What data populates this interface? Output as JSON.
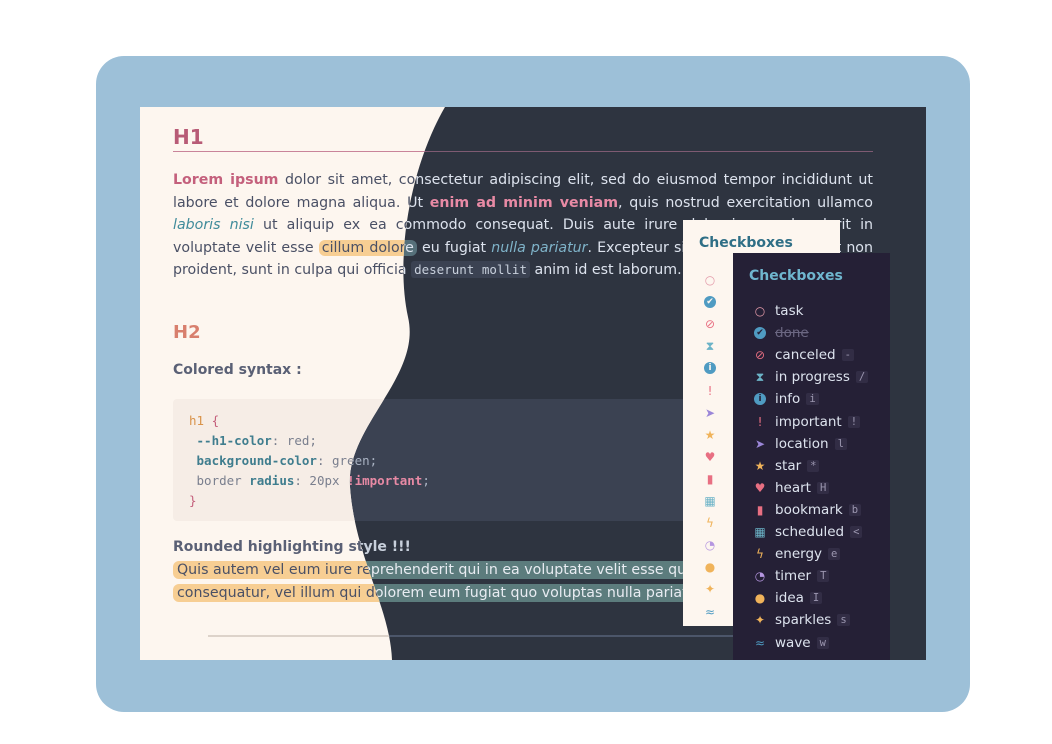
{
  "colors": {
    "frame": "#9dc0d8",
    "light_bg": "#fdf6ef",
    "dark_bg": "#2e3440",
    "h1_light": "#b85b76",
    "h2_light": "#d87f6d",
    "accent_teal": "#3f8b9a",
    "highlight_orange": "#f7ce93",
    "highlight_teal": "#5c7c7d",
    "panel_dark_bg": "#252036",
    "panel_light_bg": "#fdf6ef"
  },
  "doc": {
    "h1": "H1",
    "para": {
      "p1_bold": "Lorem ipsum",
      "p2": " dolor sit amet, consectetur adipiscing elit, sed do eiusmod tempor incididunt ut labore et dolore magna aliqua. Ut ",
      "p3_strong": "enim ad minim veniam",
      "p4": ", quis nostrud exercitation ullamco ",
      "p5_italic": "laboris nisi",
      "p6": " ut aliquip ex ea commodo consequat. Duis aute irure dolor in reprehenderit in voluptate velit esse ",
      "p7_mark": "cillum dolore",
      "p8": " eu fugiat ",
      "p9_italic": "nulla pariatur",
      "p10": ". Excepteur sint occaecat cupidatat non proident, sunt in culpa qui officia ",
      "p11_code": "deserunt mollit",
      "p12": " anim id est laborum."
    },
    "h2": "H2",
    "colored_syntax_label": "Colored syntax :",
    "code": {
      "l1_sel": "h1",
      "l1_brace": " {",
      "l2_prop": "--h1-color",
      "l2_rest": ": red;",
      "l3_prop": "background-color",
      "l3_rest": ": green;",
      "l4_a": "border ",
      "l4_b": "radius",
      "l4_c": ": 20px ",
      "l4_d": "!important",
      "l4_e": ";",
      "l5": "}"
    },
    "rounded_label": "Rounded highlighting style !!!",
    "hl_text_1": "Quis autem vel eum iure reprehenderit qui in ea voluptate velit esse quam nihil molestiae",
    "hl_text_2": "consequatur, vel illum qui dolorem eum fugiat quo voluptas nulla pariatur?"
  },
  "checkboxes": {
    "title": "Checkboxes",
    "items": [
      {
        "icon": "circle-icon",
        "glyph": "○",
        "label": "task",
        "key": "",
        "color": "#e39aa9"
      },
      {
        "icon": "check-circle-icon",
        "glyph": "✔",
        "label": "done",
        "key": "",
        "color": "#4f9bc2"
      },
      {
        "icon": "cancel-icon",
        "glyph": "⊘",
        "label": "canceled",
        "key": "-",
        "color": "#e86f82"
      },
      {
        "icon": "hourglass-icon",
        "glyph": "⧗",
        "label": "in progress",
        "key": "/",
        "color": "#6bb3c7"
      },
      {
        "icon": "info-icon",
        "glyph": "i",
        "label": "info",
        "key": "i",
        "color": "#4f9bc2"
      },
      {
        "icon": "exclamation-icon",
        "glyph": "!",
        "label": "important",
        "key": "!",
        "color": "#e86f82"
      },
      {
        "icon": "location-icon",
        "glyph": "➤",
        "label": "location",
        "key": "l",
        "color": "#9b86d8"
      },
      {
        "icon": "star-icon",
        "glyph": "★",
        "label": "star",
        "key": "*",
        "color": "#f0b35a"
      },
      {
        "icon": "heart-icon",
        "glyph": "♥",
        "label": "heart",
        "key": "H",
        "color": "#e86f82"
      },
      {
        "icon": "bookmark-icon",
        "glyph": "▮",
        "label": "bookmark",
        "key": "b",
        "color": "#e86f82"
      },
      {
        "icon": "calendar-icon",
        "glyph": "▦",
        "label": "scheduled",
        "key": "<",
        "color": "#6bb3c7"
      },
      {
        "icon": "lightning-icon",
        "glyph": "ϟ",
        "label": "energy",
        "key": "e",
        "color": "#f0b35a"
      },
      {
        "icon": "timer-icon",
        "glyph": "◔",
        "label": "timer",
        "key": "T",
        "color": "#b596e0"
      },
      {
        "icon": "lightbulb-icon",
        "glyph": "●",
        "label": "idea",
        "key": "I",
        "color": "#f0b35a"
      },
      {
        "icon": "sparkles-icon",
        "glyph": "✦",
        "label": "sparkles",
        "key": "s",
        "color": "#f0b35a"
      },
      {
        "icon": "wave-icon",
        "glyph": "≈",
        "label": "wave",
        "key": "w",
        "color": "#4f9bc2"
      }
    ]
  }
}
